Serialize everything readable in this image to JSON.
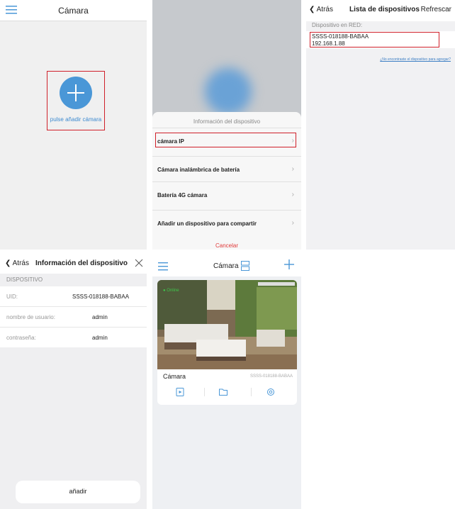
{
  "colors": {
    "accent": "#4a97d7",
    "highlight": "#d0202a",
    "online": "#3fc64c",
    "cancel": "#e03a3a"
  },
  "camera_home": {
    "title": "Cámara",
    "menu_icon": "menu-icon",
    "add_prompt": "pulse añadir cámara"
  },
  "device_type_sheet": {
    "title": "Información del dispositivo",
    "options": [
      "cámara IP",
      "Cámara inalámbrica de batería",
      "Batería 4G cámara",
      "Añadir un dispositivo para compartir"
    ],
    "cancel": "Cancelar"
  },
  "device_list": {
    "back": "Atrás",
    "title": "Lista de dispositivos",
    "refresh": "Refrescar",
    "section": "Dispositivo en RED:",
    "devices": [
      {
        "uid": "SSSS-018188-BABAA",
        "ip": "192.168.1.88"
      }
    ],
    "help_link": "¿No encontraste el dispositivo para agregar?"
  },
  "device_info": {
    "back": "Atrás",
    "title": "Información del dispositivo",
    "section": "DISPOSITIVO",
    "fields": [
      {
        "label": "UID:",
        "value": "SSSS-018188-BABAA"
      },
      {
        "label": "nombre de usuario:",
        "value": "admin"
      },
      {
        "label": "contraseña:",
        "value": "admin"
      }
    ],
    "add_button": "añadir"
  },
  "camera_list": {
    "title": "Cámara",
    "status": "Online",
    "camera_name": "Cámara",
    "camera_uid": "SSSS-018188-BABAA"
  }
}
